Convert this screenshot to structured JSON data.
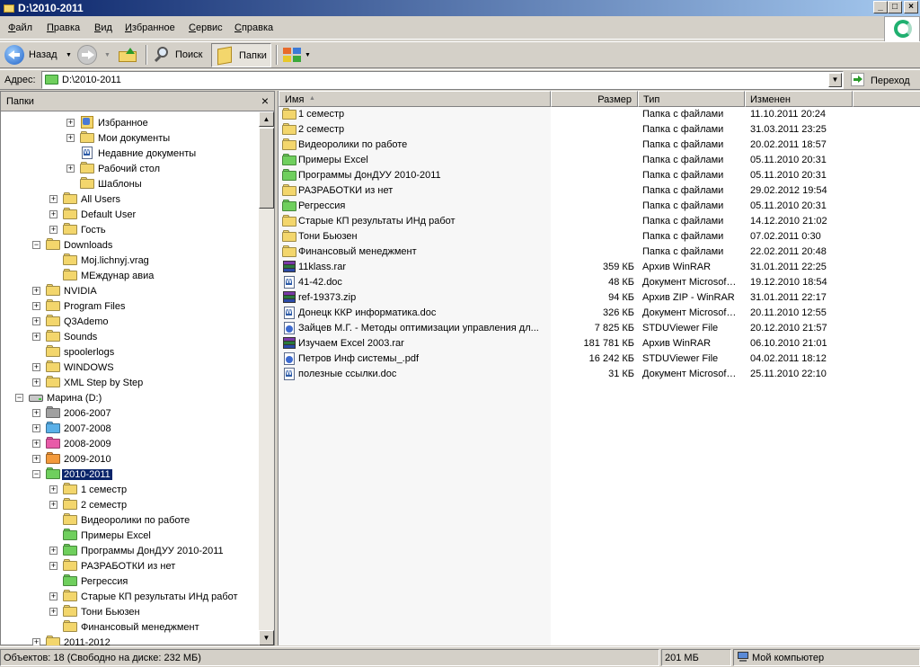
{
  "window": {
    "title": "D:\\2010-2011",
    "min_glyph": "_",
    "max_glyph": "□",
    "close_glyph": "×"
  },
  "menu": [
    {
      "label": "Файл",
      "u": "Ф",
      "rest": "айл"
    },
    {
      "label": "Правка",
      "u": "П",
      "rest": "равка"
    },
    {
      "label": "Вид",
      "u": "В",
      "rest": "ид"
    },
    {
      "label": "Избранное",
      "u": "И",
      "rest": "збранное"
    },
    {
      "label": "Сервис",
      "u": "С",
      "rest": "ервис"
    },
    {
      "label": "Справка",
      "u": "С",
      "rest": "правка"
    }
  ],
  "toolbar": {
    "back_label": "Назад",
    "search_label": "Поиск",
    "folders_label": "Папки"
  },
  "address": {
    "label": "Адрес:",
    "value": "D:\\2010-2011",
    "go_label": "Переход"
  },
  "folders_pane": {
    "title": "Папки",
    "close_glyph": "×"
  },
  "tree": [
    {
      "label": "Избранное",
      "depth": 4,
      "exp": "+",
      "icon": "star"
    },
    {
      "label": "Мои документы",
      "depth": 4,
      "exp": "+",
      "icon": "folder"
    },
    {
      "label": "Недавние документы",
      "depth": 4,
      "exp": "",
      "icon": "doc"
    },
    {
      "label": "Рабочий стол",
      "depth": 4,
      "exp": "+",
      "icon": "folder"
    },
    {
      "label": "Шаблоны",
      "depth": 4,
      "exp": "",
      "icon": "folder"
    },
    {
      "label": "All Users",
      "depth": 3,
      "exp": "+",
      "icon": "folder"
    },
    {
      "label": "Default User",
      "depth": 3,
      "exp": "+",
      "icon": "folder"
    },
    {
      "label": "Гость",
      "depth": 3,
      "exp": "+",
      "icon": "folder"
    },
    {
      "label": "Downloads",
      "depth": 2,
      "exp": "−",
      "icon": "folder"
    },
    {
      "label": "Moj.lichnyj.vrag",
      "depth": 3,
      "exp": "",
      "icon": "folder"
    },
    {
      "label": "МЕждунар авиа",
      "depth": 3,
      "exp": "",
      "icon": "folder"
    },
    {
      "label": "NVIDIA",
      "depth": 2,
      "exp": "+",
      "icon": "folder"
    },
    {
      "label": "Program Files",
      "depth": 2,
      "exp": "+",
      "icon": "folder"
    },
    {
      "label": "Q3Ademo",
      "depth": 2,
      "exp": "+",
      "icon": "folder"
    },
    {
      "label": "Sounds",
      "depth": 2,
      "exp": "+",
      "icon": "folder"
    },
    {
      "label": "spoolerlogs",
      "depth": 2,
      "exp": "",
      "icon": "folder"
    },
    {
      "label": "WINDOWS",
      "depth": 2,
      "exp": "+",
      "icon": "folder"
    },
    {
      "label": "XML Step by Step",
      "depth": 2,
      "exp": "+",
      "icon": "folder"
    },
    {
      "label": "Марина (D:)",
      "depth": 1,
      "exp": "−",
      "icon": "drive"
    },
    {
      "label": "2006-2007",
      "depth": 2,
      "exp": "+",
      "icon": "folder-gray"
    },
    {
      "label": "2007-2008",
      "depth": 2,
      "exp": "+",
      "icon": "folder-blue"
    },
    {
      "label": "2008-2009",
      "depth": 2,
      "exp": "+",
      "icon": "folder-pink"
    },
    {
      "label": "2009-2010",
      "depth": 2,
      "exp": "+",
      "icon": "folder-orange"
    },
    {
      "label": "2010-2011",
      "depth": 2,
      "exp": "−",
      "icon": "folder-green",
      "selected": true
    },
    {
      "label": "1 семестр",
      "depth": 3,
      "exp": "+",
      "icon": "folder"
    },
    {
      "label": "2 семестр",
      "depth": 3,
      "exp": "+",
      "icon": "folder"
    },
    {
      "label": "Видеоролики по работе",
      "depth": 3,
      "exp": "",
      "icon": "folder"
    },
    {
      "label": "Примеры Excel",
      "depth": 3,
      "exp": "",
      "icon": "folder-green"
    },
    {
      "label": "Программы ДонДУУ  2010-2011",
      "depth": 3,
      "exp": "+",
      "icon": "folder-green"
    },
    {
      "label": "РАЗРАБОТКИ из нет",
      "depth": 3,
      "exp": "+",
      "icon": "folder"
    },
    {
      "label": "Регрессия",
      "depth": 3,
      "exp": "",
      "icon": "folder-green"
    },
    {
      "label": "Старые КП результаты ИНд работ",
      "depth": 3,
      "exp": "+",
      "icon": "folder"
    },
    {
      "label": "Тони Бьюзен",
      "depth": 3,
      "exp": "+",
      "icon": "folder"
    },
    {
      "label": "Финансовый менеджмент",
      "depth": 3,
      "exp": "",
      "icon": "folder"
    },
    {
      "label": "2011-2012",
      "depth": 2,
      "exp": "+",
      "icon": "folder"
    }
  ],
  "scroll": {
    "up_glyph": "▲",
    "down_glyph": "▼"
  },
  "columns": [
    "Имя",
    "Размер",
    "Тип",
    "Изменен"
  ],
  "sort_glyph": "▲",
  "files": [
    {
      "name": "1 семестр",
      "size": "",
      "type": "Папка с файлами",
      "modified": "11.10.2011 20:24",
      "icon": "folder"
    },
    {
      "name": "2 семестр",
      "size": "",
      "type": "Папка с файлами",
      "modified": "31.03.2011 23:25",
      "icon": "folder"
    },
    {
      "name": "Видеоролики по работе",
      "size": "",
      "type": "Папка с файлами",
      "modified": "20.02.2011 18:57",
      "icon": "folder"
    },
    {
      "name": "Примеры Excel",
      "size": "",
      "type": "Папка с файлами",
      "modified": "05.11.2010 20:31",
      "icon": "folder-green"
    },
    {
      "name": "Программы ДонДУУ  2010-2011",
      "size": "",
      "type": "Папка с файлами",
      "modified": "05.11.2010 20:31",
      "icon": "folder-green"
    },
    {
      "name": "РАЗРАБОТКИ из нет",
      "size": "",
      "type": "Папка с файлами",
      "modified": "29.02.2012 19:54",
      "icon": "folder"
    },
    {
      "name": "Регрессия",
      "size": "",
      "type": "Папка с файлами",
      "modified": "05.11.2010 20:31",
      "icon": "folder-green"
    },
    {
      "name": "Старые КП результаты ИНд работ",
      "size": "",
      "type": "Папка с файлами",
      "modified": "14.12.2010 21:02",
      "icon": "folder"
    },
    {
      "name": "Тони Бьюзен",
      "size": "",
      "type": "Папка с файлами",
      "modified": "07.02.2011 0:30",
      "icon": "folder"
    },
    {
      "name": "Финансовый менеджмент",
      "size": "",
      "type": "Папка с файлами",
      "modified": "22.02.2011 20:48",
      "icon": "folder"
    },
    {
      "name": "11klass.rar",
      "size": "359 КБ",
      "type": "Архив WinRAR",
      "modified": "31.01.2011 22:25",
      "icon": "rar"
    },
    {
      "name": "41-42.doc",
      "size": "48 КБ",
      "type": "Документ Microsof…",
      "modified": "19.12.2010 18:54",
      "icon": "doc"
    },
    {
      "name": "ref-19373.zip",
      "size": "94 КБ",
      "type": "Архив ZIP - WinRAR",
      "modified": "31.01.2011 22:17",
      "icon": "rar"
    },
    {
      "name": "Донецк ККР информатика.doc",
      "size": "326 КБ",
      "type": "Документ Microsof…",
      "modified": "20.11.2010 12:55",
      "icon": "doc"
    },
    {
      "name": "Зайцев М.Г. -  Методы оптимизации управления дл...",
      "size": "7 825 КБ",
      "type": "STDUViewer File",
      "modified": "20.12.2010 21:57",
      "icon": "stdu"
    },
    {
      "name": "Изучаем Excel 2003.rar",
      "size": "181 781 КБ",
      "type": "Архив WinRAR",
      "modified": "06.10.2010 21:01",
      "icon": "rar"
    },
    {
      "name": "Петров Инф системы_.pdf",
      "size": "16 242 КБ",
      "type": "STDUViewer File",
      "modified": "04.02.2011 18:12",
      "icon": "stdu"
    },
    {
      "name": "полезные ссылки.doc",
      "size": "31 КБ",
      "type": "Документ Microsof…",
      "modified": "25.11.2010 22:10",
      "icon": "doc"
    }
  ],
  "status": {
    "objects": "Объектов: 18 (Свободно на диске: 232 МБ)",
    "size": "201 МБ",
    "location": "Мой компьютер"
  },
  "colors": {
    "folder": "#f3d66c",
    "folder_green": "#6fcf5d",
    "folder_blue": "#5ab0e8",
    "folder_pink": "#e85aa8",
    "folder_orange": "#f39a3c",
    "folder_gray": "#a0a0a0",
    "selection": "#0a246a"
  }
}
